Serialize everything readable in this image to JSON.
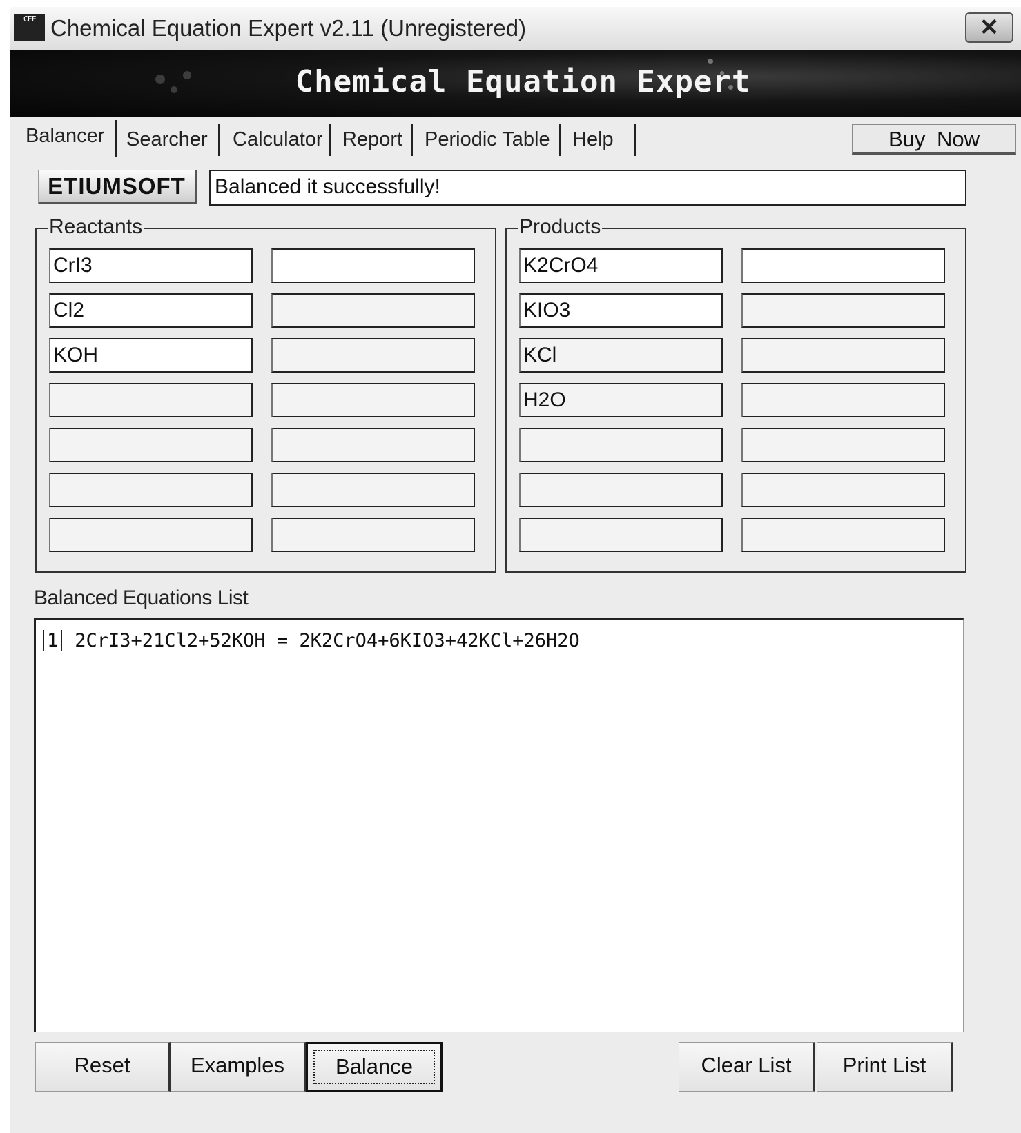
{
  "window": {
    "title": "Chemical Equation Expert v2.11 (Unregistered)",
    "icon_text": "CEE",
    "close_label": "✕"
  },
  "banner": {
    "title": "Chemical Equation Expert"
  },
  "tabs": [
    {
      "label": "Balancer",
      "active": true
    },
    {
      "label": "Searcher",
      "active": false
    },
    {
      "label": "Calculator",
      "active": false
    },
    {
      "label": "Report",
      "active": false
    },
    {
      "label": "Periodic Table",
      "active": false
    },
    {
      "label": "Help",
      "active": false
    }
  ],
  "buy_now_label": "Buy Now",
  "logo_label": "ETIUMSOFT",
  "status_message": "Balanced it successfully!",
  "reactants": {
    "legend": "Reactants",
    "fields": [
      [
        "CrI3",
        ""
      ],
      [
        "Cl2",
        ""
      ],
      [
        "KOH",
        ""
      ],
      [
        "",
        ""
      ],
      [
        "",
        ""
      ],
      [
        "",
        ""
      ],
      [
        "",
        ""
      ]
    ]
  },
  "products": {
    "legend": "Products",
    "fields": [
      [
        "K2CrO4",
        ""
      ],
      [
        "KIO3",
        ""
      ],
      [
        "KCl",
        ""
      ],
      [
        "H2O",
        ""
      ],
      [
        "",
        ""
      ],
      [
        "",
        ""
      ],
      [
        "",
        ""
      ]
    ]
  },
  "balanced_list": {
    "label": "Balanced Equations List",
    "items": [
      {
        "index": "1",
        "equation": "2CrI3+21Cl2+52KOH = 2K2CrO4+6KIO3+42KCl+26H2O"
      }
    ]
  },
  "buttons": {
    "reset": "Reset",
    "examples": "Examples",
    "balance": "Balance",
    "clear_list": "Clear List",
    "print_list": "Print List"
  }
}
